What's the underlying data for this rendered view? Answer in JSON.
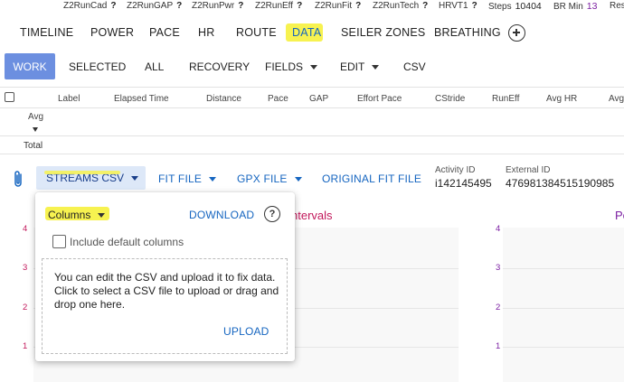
{
  "metrics": [
    {
      "label": "Z2RunCad",
      "value": "?"
    },
    {
      "label": "Z2RunGAP",
      "value": "?"
    },
    {
      "label": "Z2RunPwr",
      "value": "?"
    },
    {
      "label": "Z2RunEff",
      "value": "?"
    },
    {
      "label": "Z2RunFit",
      "value": "?"
    },
    {
      "label": "Z2RunTech",
      "value": "?"
    },
    {
      "label": "HRVT1",
      "value": "?"
    },
    {
      "label": "Steps",
      "value": "10404"
    },
    {
      "label": "BR Min",
      "value": "13"
    },
    {
      "label": "Res",
      "value": ""
    }
  ],
  "tabs": [
    "TIMELINE",
    "POWER",
    "PACE",
    "HR",
    "ROUTE",
    "DATA",
    "SEILER ZONES",
    "BREATHING"
  ],
  "active_tab": "DATA",
  "subbar": {
    "work": "WORK",
    "selected": "SELECTED",
    "all": "ALL",
    "recovery": "RECOVERY",
    "fields": "FIELDS",
    "edit": "EDIT",
    "csv": "CSV"
  },
  "table": {
    "columns": [
      "Label",
      "Elapsed Time",
      "Distance",
      "Pace",
      "GAP",
      "Effort Pace",
      "CStride",
      "RunEff",
      "Avg HR",
      "Avg"
    ],
    "avg_column": "Avg",
    "total_label": "Total"
  },
  "files": {
    "streams_csv": "STREAMS CSV",
    "fit_file": "FIT FILE",
    "gpx_file": "GPX FILE",
    "original_fit": "ORIGINAL FIT FILE",
    "activity_id_label": "Activity ID",
    "activity_id": "i142145495",
    "external_id_label": "External ID",
    "external_id": "476981384515190985"
  },
  "background_charts": {
    "left_title_fragment": "ntervals",
    "right_title_fragment": "Pc",
    "y_ticks": [
      "4",
      "3",
      "2",
      "1"
    ]
  },
  "popup": {
    "columns_label": "Columns",
    "download_label": "DOWNLOAD",
    "help_glyph": "?",
    "include_default": "Include default columns",
    "drop_text": "You can edit the CSV and upload it to fix data. Click to select a CSV file to upload or drag and drop one here.",
    "upload_label": "UPLOAD"
  },
  "colors": {
    "accent_blue": "#1565c0",
    "work_button": "#6c8fe0",
    "highlight": "#f7f250",
    "chart_pink": "#c2185b",
    "chart_purple": "#7b1fa2"
  }
}
